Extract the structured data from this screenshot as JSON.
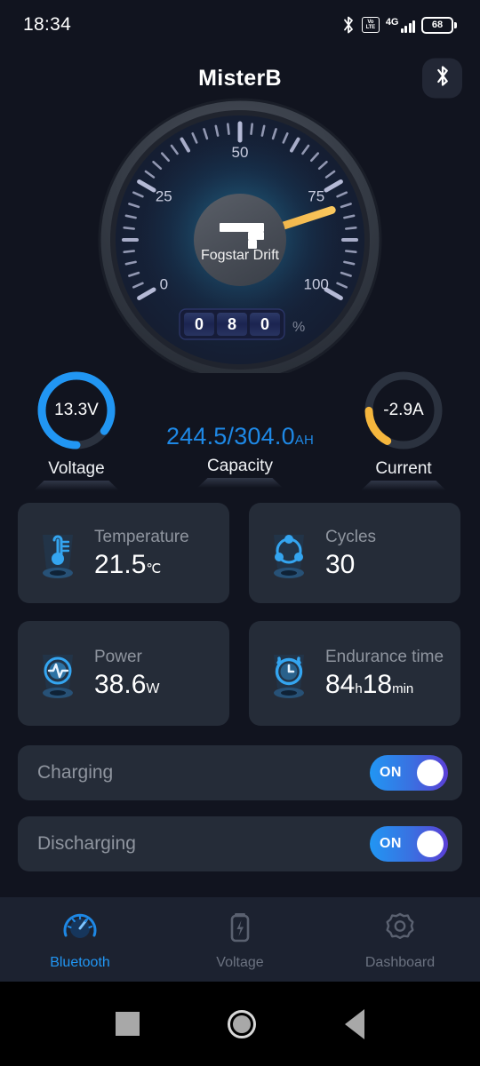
{
  "status_bar": {
    "time": "18:34",
    "bluetooth_icon": "bluetooth-icon",
    "volte_top": "Vo",
    "volte_bottom": "LTE",
    "network_type": "4G",
    "battery_percent": "68"
  },
  "header": {
    "title": "MisterB",
    "bluetooth_button_icon": "bluetooth-icon"
  },
  "gauge": {
    "brand": "Fogstar Drift",
    "tick_labels": [
      "0",
      "25",
      "50",
      "75",
      "100"
    ],
    "min": 0,
    "max": 100,
    "value": 80,
    "digits": [
      "0",
      "8",
      "0"
    ],
    "unit": "%",
    "needle_color": "#f5b63d",
    "glow_color": "#1a6e8e"
  },
  "stats": {
    "voltage": {
      "label": "Voltage",
      "value": "13.3V",
      "ring_percent": 85,
      "ring_color": "#2196f3"
    },
    "capacity": {
      "label": "Capacity",
      "value": "244.5/304.0",
      "unit": "AH",
      "color": "#1e88e5"
    },
    "current": {
      "label": "Current",
      "value": "-2.9A",
      "ring_percent": 17,
      "ring_color": "#f5b63d"
    }
  },
  "cards": [
    {
      "icon": "thermometer-icon",
      "label": "Temperature",
      "value": "21.5",
      "unit": "℃"
    },
    {
      "icon": "cycles-icon",
      "label": "Cycles",
      "value": "30",
      "unit": ""
    },
    {
      "icon": "power-pulse-icon",
      "label": "Power",
      "value": "38.6",
      "unit": "W"
    },
    {
      "icon": "alarm-clock-icon",
      "label": "Endurance time",
      "value": "84",
      "unit": "h",
      "value2": "18",
      "unit2": "min"
    }
  ],
  "toggles": [
    {
      "label": "Charging",
      "state": "ON"
    },
    {
      "label": "Discharging",
      "state": "ON"
    }
  ],
  "bottom_nav": [
    {
      "icon": "speedometer-icon",
      "label": "Bluetooth",
      "active": true
    },
    {
      "icon": "battery-icon",
      "label": "Voltage",
      "active": false
    },
    {
      "icon": "gear-icon",
      "label": "Dashboard",
      "active": false
    }
  ],
  "android_nav": {
    "recent_icon": "square-recents-icon",
    "home_icon": "circle-home-icon",
    "back_icon": "triangle-back-icon"
  }
}
